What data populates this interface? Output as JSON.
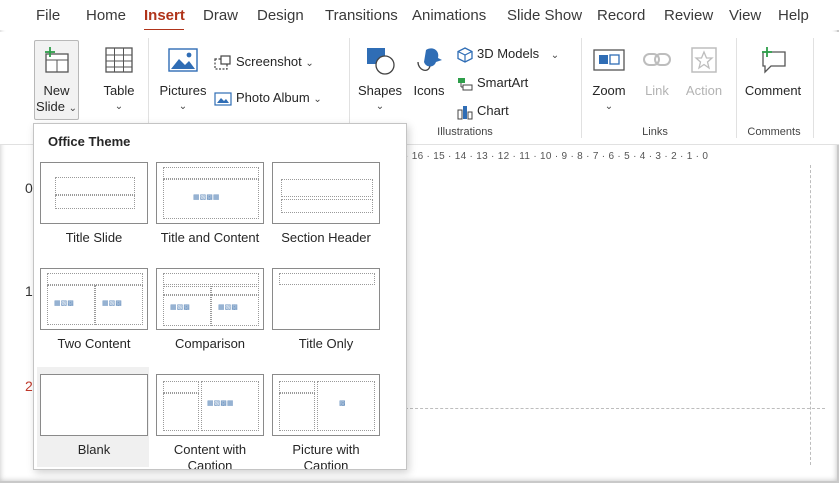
{
  "menu": {
    "items": [
      "File",
      "Home",
      "Insert",
      "Draw",
      "Design",
      "Transitions",
      "Animations",
      "Slide Show",
      "Record",
      "Review",
      "View",
      "Help"
    ],
    "active": "Insert"
  },
  "ribbon": {
    "new_slide": {
      "line1": "New",
      "line2": "Slide"
    },
    "table": {
      "label": "Table"
    },
    "pictures": {
      "label": "Pictures"
    },
    "screenshot": {
      "label": "Screenshot"
    },
    "photo_album": {
      "label": "Photo Album"
    },
    "shapes": {
      "label": "Shapes"
    },
    "icons": {
      "label": "Icons"
    },
    "models3d": {
      "label": "3D Models"
    },
    "smartart": {
      "label": "SmartArt"
    },
    "chart": {
      "label": "Chart"
    },
    "zoom": {
      "label": "Zoom"
    },
    "link": {
      "label": "Link"
    },
    "action": {
      "label": "Action"
    },
    "comment": {
      "label": "Comment"
    },
    "groups": {
      "illustrations": "Illustrations",
      "links": "Links",
      "comments": "Comments"
    }
  },
  "ruler": {
    "text": "· 16 · 15 · 14 · 13 · 12 · 11 · 10 · 9 · 8 · 7 · 6 · 5 · 4 · 3 · 2 · 1 · 0"
  },
  "thumbnails": {
    "n0": "0",
    "n1": "1",
    "n2": "2"
  },
  "dropdown": {
    "title": "Office Theme",
    "layouts": [
      {
        "label": "Title Slide"
      },
      {
        "label": "Title and Content"
      },
      {
        "label": "Section Header"
      },
      {
        "label": "Two Content"
      },
      {
        "label": "Comparison"
      },
      {
        "label": "Title Only"
      },
      {
        "label": "Blank"
      },
      {
        "label": "Content with Caption"
      },
      {
        "label": "Picture with Caption"
      }
    ]
  },
  "colors": {
    "accent": "#b0341a",
    "icon_blue": "#2f6db5"
  }
}
